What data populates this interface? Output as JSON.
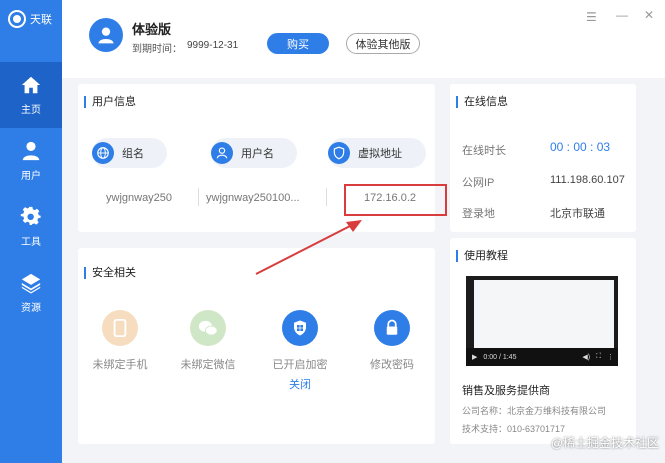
{
  "app": {
    "logo_text": "天联"
  },
  "sidebar": {
    "items": [
      {
        "label": "主页"
      },
      {
        "label": "用户"
      },
      {
        "label": "工具"
      },
      {
        "label": "资源"
      }
    ]
  },
  "header": {
    "edition": "体验版",
    "expire_label": "到期时间：",
    "expire_value": "9999-12-31",
    "buy_label": "购买",
    "other_label": "体验其他版"
  },
  "user_info": {
    "title": "用户信息",
    "fields": [
      {
        "label": "组名",
        "value": "ywjgnway250"
      },
      {
        "label": "用户名",
        "value": "ywjgnway250100..."
      },
      {
        "label": "虚拟地址",
        "value": "172.16.0.2"
      }
    ]
  },
  "security": {
    "title": "安全相关",
    "items": [
      {
        "label": "未绑定手机"
      },
      {
        "label": "未绑定微信"
      },
      {
        "label": "已开启加密",
        "link": "关闭"
      },
      {
        "label": "修改密码"
      }
    ]
  },
  "online": {
    "title": "在线信息",
    "rows": [
      {
        "label": "在线时长",
        "value": "00 : 00 : 03"
      },
      {
        "label": "公网IP",
        "value": "111.198.60.107"
      },
      {
        "label": "登录地",
        "value": "北京市联通"
      }
    ]
  },
  "tutorial": {
    "title": "使用教程",
    "video_time": "0:00 / 1:45",
    "provider_title": "销售及服务提供商",
    "company_line": "公司名称：北京金万维科技有限公司",
    "support_line": "技术支持：010-63701717"
  },
  "watermark": "@稀土掘金技术社区",
  "colors": {
    "accent": "#2f7ee8",
    "sidebar_active": "#1e63c8",
    "highlight": "#d83c3c"
  }
}
